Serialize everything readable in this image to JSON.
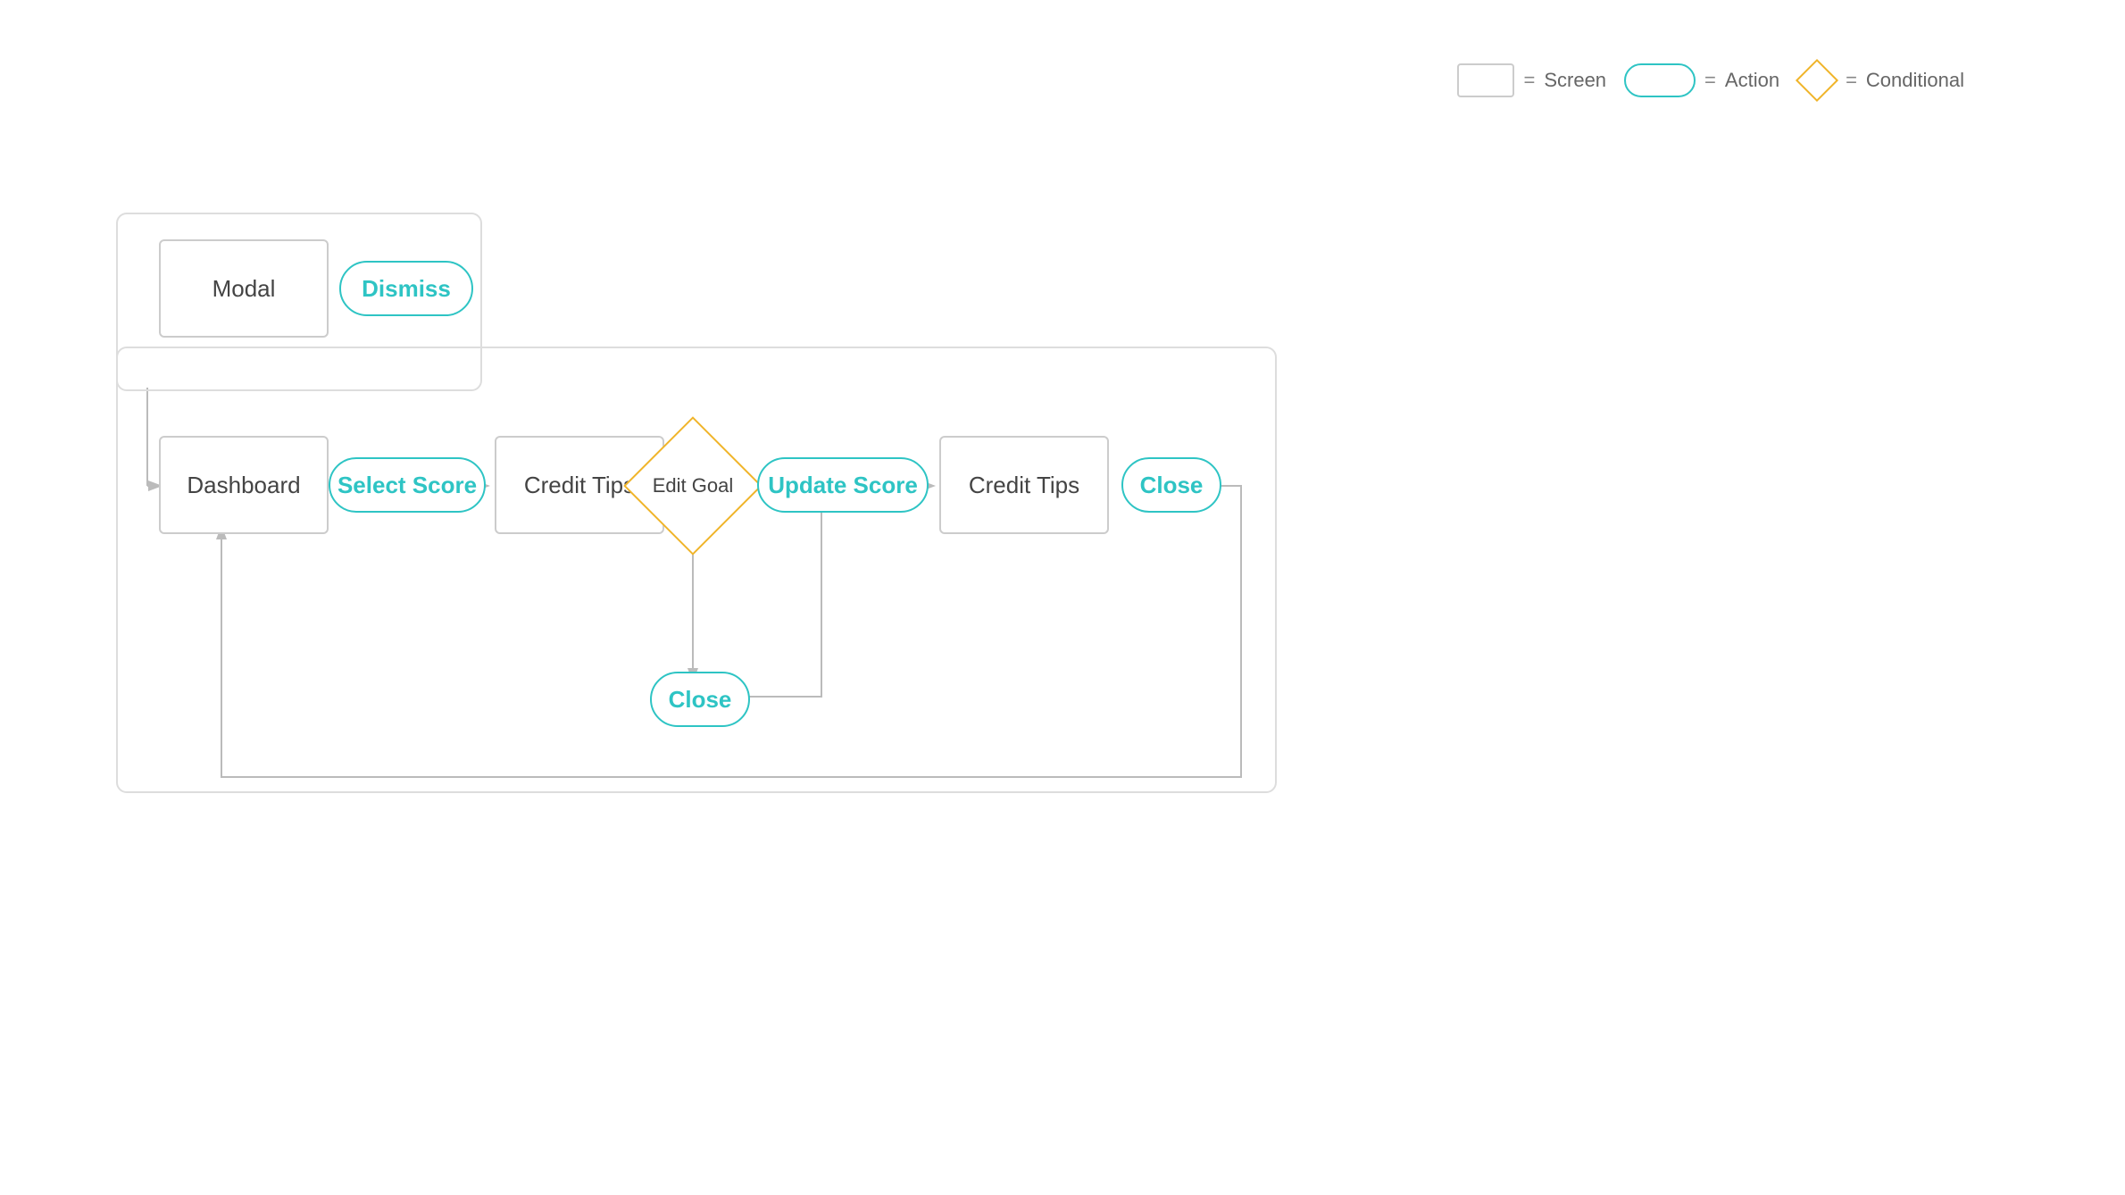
{
  "legend": {
    "screen_label": "Screen",
    "action_label": "Action",
    "conditional_label": "Conditional",
    "eq": "="
  },
  "nodes": {
    "modal": "Modal",
    "dismiss": "Dismiss",
    "dashboard": "Dashboard",
    "select_score": "Select Score",
    "credit_tips_1": "Credit Tips",
    "edit_goal": "Edit Goal",
    "update_score": "Update Score",
    "credit_tips_2": "Credit Tips",
    "close_1": "Close",
    "close_2": "Close"
  }
}
